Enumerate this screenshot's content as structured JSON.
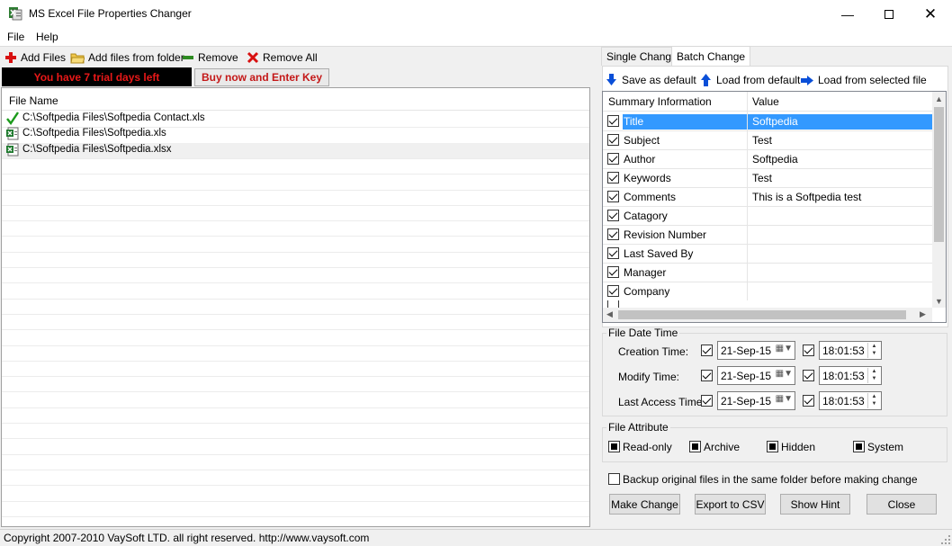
{
  "window": {
    "title": "MS Excel File Properties Changer"
  },
  "menu": [
    "File",
    "Help"
  ],
  "toolbar": {
    "add_files": "Add Files",
    "add_folder": "Add files from folder",
    "remove": "Remove",
    "remove_all": "Remove All"
  },
  "trial": {
    "message": "You have 7 trial days left",
    "buy": "Buy now and Enter Key"
  },
  "file_list": {
    "header": "File Name",
    "files": [
      {
        "name": "C:\\Softpedia Files\\Softpedia Contact.xls",
        "status": "check-icon"
      },
      {
        "name": "C:\\Softpedia Files\\Softpedia.xls",
        "status": "excel-icon"
      },
      {
        "name": "C:\\Softpedia Files\\Softpedia.xlsx",
        "status": "excel-icon"
      }
    ]
  },
  "tabs": [
    "Single Change",
    "Batch Change"
  ],
  "active_tab": "Batch Change",
  "batch_toolbar": {
    "save_default": "Save as default",
    "load_default": "Load from default",
    "load_file": "Load from selected file"
  },
  "summary": {
    "col_name": "Summary Information",
    "col_value": "Value",
    "rows": [
      {
        "name": "Title",
        "value": "Softpedia",
        "checked": true,
        "selected": true
      },
      {
        "name": "Subject",
        "value": "Test",
        "checked": true
      },
      {
        "name": "Author",
        "value": "Softpedia",
        "checked": true
      },
      {
        "name": "Keywords",
        "value": "Test",
        "checked": true
      },
      {
        "name": "Comments",
        "value": "This is a Softpedia test",
        "checked": true
      },
      {
        "name": "Catagory",
        "value": "",
        "checked": true
      },
      {
        "name": "Revision Number",
        "value": "",
        "checked": true
      },
      {
        "name": "Last Saved By",
        "value": "",
        "checked": true
      },
      {
        "name": "Manager",
        "value": "",
        "checked": true
      },
      {
        "name": "Company",
        "value": "",
        "checked": true
      }
    ]
  },
  "file_date_time": {
    "legend": "File Date Time",
    "rows": [
      {
        "label": "Creation Time:",
        "date": "21-Sep-15",
        "time": "18:01:53"
      },
      {
        "label": "Modify Time:",
        "date": "21-Sep-15",
        "time": "18:01:53"
      },
      {
        "label": "Last Access Time:",
        "date": "21-Sep-15",
        "time": "18:01:53"
      }
    ]
  },
  "file_attribute": {
    "legend": "File Attribute",
    "items": [
      "Read-only",
      "Archive",
      "Hidden",
      "System"
    ]
  },
  "backup": {
    "label": "Backup original files in the same folder before making change"
  },
  "buttons": {
    "make_change": "Make Change",
    "export_csv": "Export to CSV",
    "show_hint": "Show Hint",
    "close": "Close"
  },
  "status": {
    "text": "Copyright 2007-2010 VaySoft LTD. all right reserved. http://www.vaysoft.com"
  },
  "colors": {
    "selection": "#3399ff",
    "trial_text": "#e81818",
    "buy_text": "#c41818",
    "accent_arrow": "#0a4fd8"
  }
}
